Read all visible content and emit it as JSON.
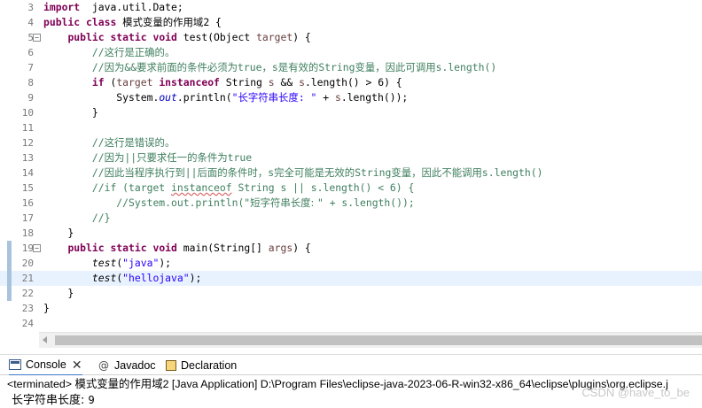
{
  "editor": {
    "lines": [
      {
        "n": "3",
        "fold": "",
        "segs": [
          [
            "kw",
            "import"
          ],
          [
            "",
            "  java.util.Date;"
          ]
        ]
      },
      {
        "n": "4",
        "fold": "",
        "segs": [
          [
            "kw",
            "public"
          ],
          [
            "",
            " "
          ],
          [
            "kw",
            "class"
          ],
          [
            "",
            " "
          ],
          [
            "cjk",
            "模式变量的作用域"
          ],
          [
            "",
            "2 {"
          ]
        ]
      },
      {
        "n": "5",
        "fold": "⊖",
        "segs": [
          [
            "",
            "    "
          ],
          [
            "kw",
            "public"
          ],
          [
            "",
            " "
          ],
          [
            "kw",
            "static"
          ],
          [
            "",
            " "
          ],
          [
            "kw",
            "void"
          ],
          [
            "",
            " test(Object "
          ],
          [
            "pa",
            "target"
          ],
          [
            "",
            ") {"
          ]
        ]
      },
      {
        "n": "6",
        "fold": "",
        "segs": [
          [
            "",
            "        "
          ],
          [
            "cm",
            "//"
          ],
          [
            "cm cjk",
            "这行是正确的。"
          ]
        ]
      },
      {
        "n": "7",
        "fold": "",
        "segs": [
          [
            "",
            "        "
          ],
          [
            "cm",
            "//"
          ],
          [
            "cm cjk",
            "因为"
          ],
          [
            "cm",
            "&&"
          ],
          [
            "cm cjk",
            "要求前面的条件必须为"
          ],
          [
            "cm",
            "true"
          ],
          [
            "cm cjk",
            "，"
          ],
          [
            "cm",
            "s"
          ],
          [
            "cm cjk",
            "是有效的"
          ],
          [
            "cm",
            "String"
          ],
          [
            "cm cjk",
            "变量，因此可调用"
          ],
          [
            "cm",
            "s.length()"
          ]
        ]
      },
      {
        "n": "8",
        "fold": "",
        "segs": [
          [
            "",
            "        "
          ],
          [
            "kw",
            "if"
          ],
          [
            "",
            " ("
          ],
          [
            "pa",
            "target"
          ],
          [
            "",
            " "
          ],
          [
            "kw",
            "instanceof"
          ],
          [
            "",
            " String "
          ],
          [
            "pa",
            "s"
          ],
          [
            "",
            " && "
          ],
          [
            "pa",
            "s"
          ],
          [
            "",
            ".length() > 6) {"
          ]
        ]
      },
      {
        "n": "9",
        "fold": "",
        "segs": [
          [
            "",
            "            System."
          ],
          [
            "fd",
            "out"
          ],
          [
            "",
            ".println("
          ],
          [
            "st",
            "\"长字符串长度: \""
          ],
          [
            "",
            " + "
          ],
          [
            "pa",
            "s"
          ],
          [
            "",
            ".length());"
          ]
        ]
      },
      {
        "n": "10",
        "fold": "",
        "segs": [
          [
            "",
            "        }"
          ]
        ]
      },
      {
        "n": "11",
        "fold": "",
        "segs": [
          [
            "",
            ""
          ]
        ]
      },
      {
        "n": "12",
        "fold": "",
        "segs": [
          [
            "",
            "        "
          ],
          [
            "cm",
            "//"
          ],
          [
            "cm cjk",
            "这行是错误的。"
          ]
        ]
      },
      {
        "n": "13",
        "fold": "",
        "segs": [
          [
            "",
            "        "
          ],
          [
            "cm",
            "//"
          ],
          [
            "cm cjk",
            "因为"
          ],
          [
            "cm",
            "||"
          ],
          [
            "cm cjk",
            "只要求任一的条件为"
          ],
          [
            "cm",
            "true"
          ]
        ]
      },
      {
        "n": "14",
        "fold": "",
        "segs": [
          [
            "",
            "        "
          ],
          [
            "cm",
            "//"
          ],
          [
            "cm cjk",
            "因此当程序执行到"
          ],
          [
            "cm",
            "||"
          ],
          [
            "cm cjk",
            "后面的条件时，"
          ],
          [
            "cm",
            "s"
          ],
          [
            "cm cjk",
            "完全可能是无效的"
          ],
          [
            "cm",
            "String"
          ],
          [
            "cm cjk",
            "变量，因此不能调用"
          ],
          [
            "cm",
            "s.length()"
          ]
        ]
      },
      {
        "n": "15",
        "fold": "",
        "segs": [
          [
            "",
            "        "
          ],
          [
            "cm",
            "//if (target "
          ],
          [
            "cm squiggle",
            "instanceof"
          ],
          [
            "cm",
            " String s || s.length() < 6) {"
          ]
        ]
      },
      {
        "n": "16",
        "fold": "",
        "segs": [
          [
            "",
            "            "
          ],
          [
            "cm",
            "//System.out.println(\""
          ],
          [
            "cm cjk",
            "短字符串长度: "
          ],
          [
            "cm",
            "\" + s.length());"
          ]
        ]
      },
      {
        "n": "17",
        "fold": "",
        "segs": [
          [
            "",
            "        "
          ],
          [
            "cm",
            "//}"
          ]
        ]
      },
      {
        "n": "18",
        "fold": "",
        "segs": [
          [
            "",
            "    }"
          ]
        ]
      },
      {
        "n": "19",
        "fold": "⊖",
        "segs": [
          [
            "",
            "    "
          ],
          [
            "kw",
            "public"
          ],
          [
            "",
            " "
          ],
          [
            "kw",
            "static"
          ],
          [
            "",
            " "
          ],
          [
            "kw",
            "void"
          ],
          [
            "",
            " main(String[] "
          ],
          [
            "pa",
            "args"
          ],
          [
            "",
            ") {"
          ]
        ]
      },
      {
        "n": "20",
        "fold": "",
        "segs": [
          [
            "",
            "        "
          ],
          [
            "mi",
            "test"
          ],
          [
            "",
            "("
          ],
          [
            "st",
            "\"java\""
          ],
          [
            "",
            ");"
          ]
        ]
      },
      {
        "n": "21",
        "fold": "",
        "segs": [
          [
            "",
            "        "
          ],
          [
            "mi",
            "test"
          ],
          [
            "",
            "("
          ],
          [
            "st",
            "\"hellojava\""
          ],
          [
            "",
            ");"
          ]
        ]
      },
      {
        "n": "22",
        "fold": "",
        "segs": [
          [
            "",
            "    }"
          ]
        ]
      },
      {
        "n": "23",
        "fold": "",
        "segs": [
          [
            "",
            "}"
          ]
        ]
      },
      {
        "n": "24",
        "fold": "",
        "segs": [
          [
            "",
            ""
          ]
        ]
      }
    ],
    "current_line": "21"
  },
  "tabs": [
    {
      "label": "Console",
      "icon": "console-icon",
      "active": true,
      "closable": true
    },
    {
      "label": "Javadoc",
      "icon": "javadoc-icon",
      "active": false,
      "closable": false
    },
    {
      "label": "Declaration",
      "icon": "declaration-icon",
      "active": false,
      "closable": false
    }
  ],
  "console": {
    "terminated_line": "<terminated> 模式变量的作用域2 [Java Application] D:\\Program Files\\eclipse-java-2023-06-R-win32-x86_64\\eclipse\\plugins\\org.eclipse.j",
    "output_label": "长字符串长度: ",
    "output_value": "9",
    "watermark": "CSDN @have_to_be"
  }
}
